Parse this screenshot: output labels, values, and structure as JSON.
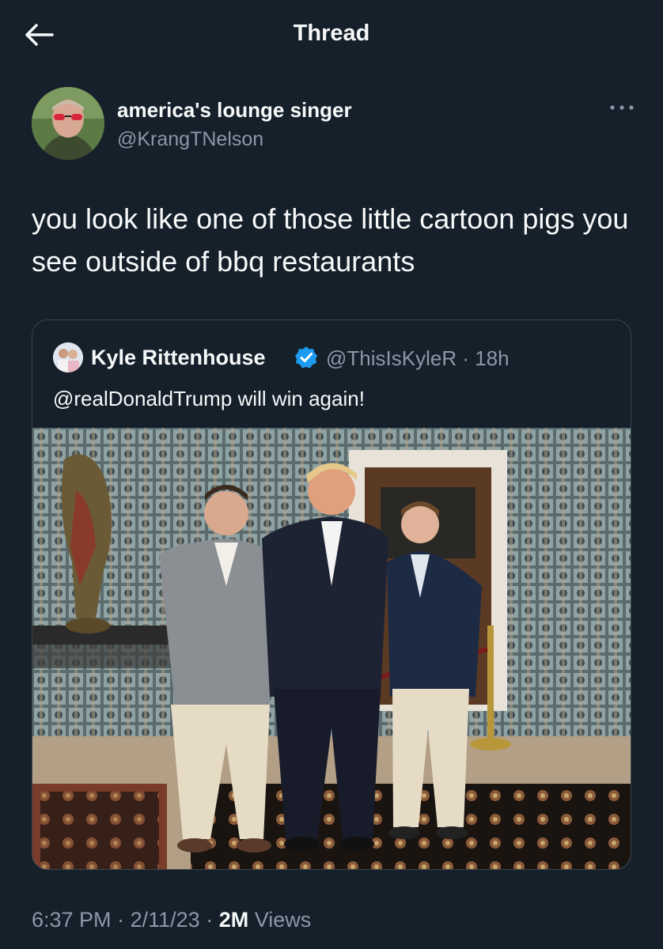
{
  "header": {
    "title": "Thread",
    "back_icon": "arrow-left-icon"
  },
  "tweet": {
    "author_name": "america's lounge singer",
    "author_handle": "@KrangTNelson",
    "more_icon": "more-horizontal-icon",
    "text": "you look like one of those little cartoon pigs you see outside of bbq restaurants",
    "time": "6:37 PM",
    "date": "2/11/23",
    "views_count": "2M",
    "views_label": "Views",
    "separator": "·"
  },
  "quoted_tweet": {
    "author_name": "Kyle Rittenhouse",
    "verified_icon": "verified-badge-icon",
    "handle_time": "@ThisIsKyleR · 18h",
    "text": "@realDonaldTrump will win again!"
  },
  "colors": {
    "background": "#15202b",
    "text_primary": "#f7f9f9",
    "text_secondary": "#8b98a5",
    "border": "#38444d",
    "verified": "#1d9bf0"
  }
}
